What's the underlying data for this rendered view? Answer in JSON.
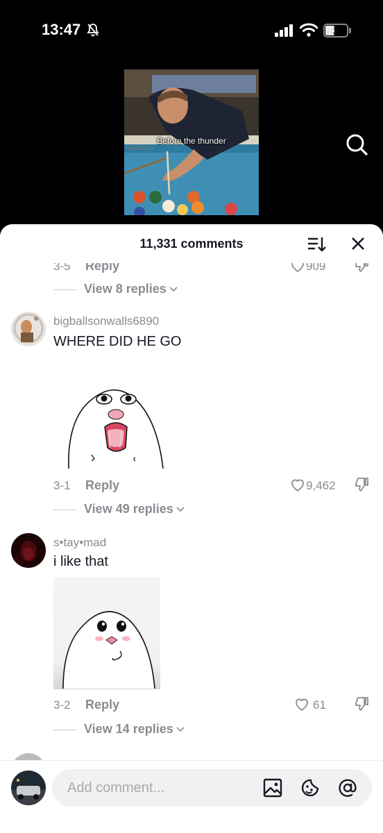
{
  "status_bar": {
    "time": "13:47",
    "battery_level": "2"
  },
  "video": {
    "caption": "Before the thunder"
  },
  "header": {
    "comment_count": "11,331 comments"
  },
  "partial_comment": {
    "date": "3-5",
    "reply_label": "Reply",
    "like_count": "909"
  },
  "partial_view_replies": "View 8 replies",
  "comments": [
    {
      "username": "bigballsonwalls6890",
      "text": "WHERE DID HE GO",
      "date": "3-1",
      "reply_label": "Reply",
      "like_count": "9,462",
      "view_replies": "View 49 replies"
    },
    {
      "username": "s•tay•mad",
      "text": "i like that",
      "date": "3-2",
      "reply_label": "Reply",
      "like_count": "61",
      "view_replies": "View 14 replies"
    }
  ],
  "input": {
    "placeholder": "Add comment..."
  },
  "icons": {
    "mute": "bell-off-icon",
    "search": "search-icon",
    "sort": "sort-icon",
    "close": "close-icon",
    "like": "heart-icon",
    "dislike": "dislike-icon",
    "image": "image-icon",
    "emoji": "emoji-icon",
    "mention": "at-icon"
  },
  "colors": {
    "primary_text": "#161823",
    "secondary_text": "#8a8b91",
    "input_bg": "#f1f1f2"
  }
}
